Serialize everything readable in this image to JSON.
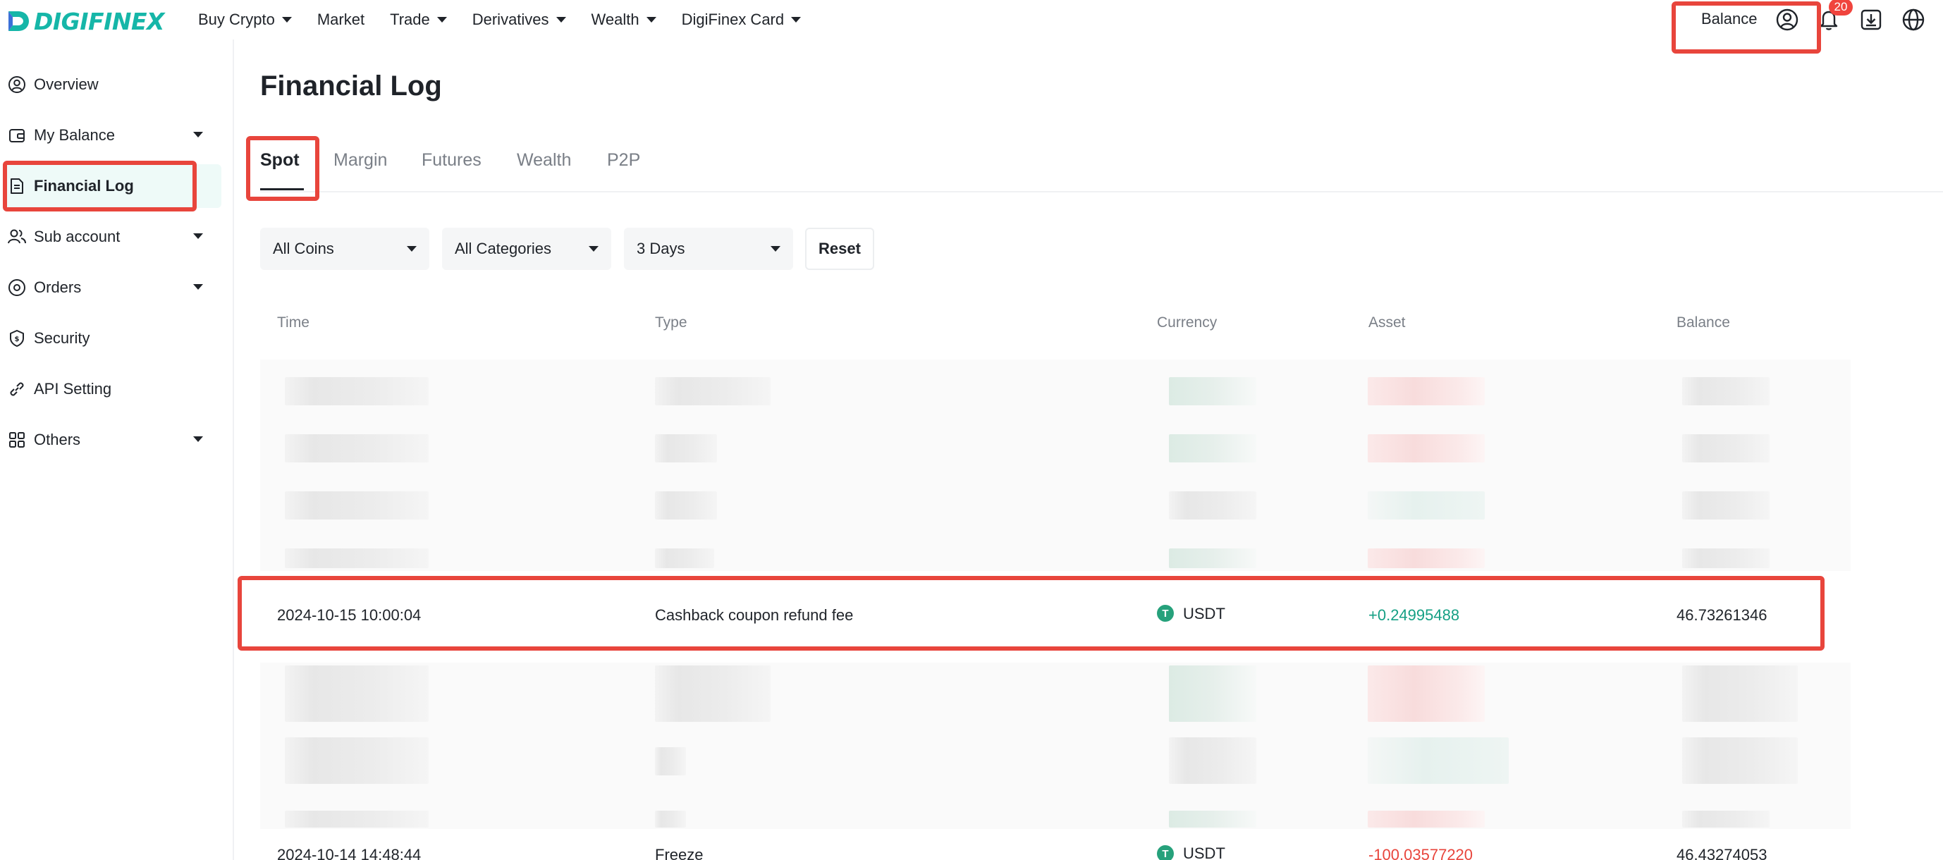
{
  "brand": {
    "name": "DIGIFINEX",
    "accent": "#16b6a8"
  },
  "nav": {
    "items": [
      {
        "label": "Buy Crypto",
        "has_dropdown": true
      },
      {
        "label": "Market",
        "has_dropdown": false
      },
      {
        "label": "Trade",
        "has_dropdown": true
      },
      {
        "label": "Derivatives",
        "has_dropdown": true
      },
      {
        "label": "Wealth",
        "has_dropdown": true
      },
      {
        "label": "DigiFinex Card",
        "has_dropdown": true
      }
    ],
    "balance_label": "Balance",
    "notification_count": "20",
    "icons": [
      "user-icon",
      "bell-icon",
      "download-icon",
      "globe-icon"
    ]
  },
  "sidebar": {
    "items": [
      {
        "label": "Overview",
        "icon": "user-circle-icon",
        "has_dropdown": false,
        "active": false
      },
      {
        "label": "My Balance",
        "icon": "wallet-icon",
        "has_dropdown": true,
        "active": false
      },
      {
        "label": "Financial Log",
        "icon": "document-icon",
        "has_dropdown": false,
        "active": true
      },
      {
        "label": "Sub account",
        "icon": "users-icon",
        "has_dropdown": true,
        "active": false
      },
      {
        "label": "Orders",
        "icon": "target-icon",
        "has_dropdown": true,
        "active": false
      },
      {
        "label": "Security",
        "icon": "shield-icon",
        "has_dropdown": false,
        "active": false
      },
      {
        "label": "API Setting",
        "icon": "link-icon",
        "has_dropdown": false,
        "active": false
      },
      {
        "label": "Others",
        "icon": "grid-icon",
        "has_dropdown": true,
        "active": false
      }
    ]
  },
  "main": {
    "title": "Financial Log",
    "tabs": [
      {
        "label": "Spot",
        "active": true
      },
      {
        "label": "Margin",
        "active": false
      },
      {
        "label": "Futures",
        "active": false
      },
      {
        "label": "Wealth",
        "active": false
      },
      {
        "label": "P2P",
        "active": false
      }
    ],
    "filters": {
      "coin": "All Coins",
      "category": "All Categories",
      "period": "3 Days",
      "reset_label": "Reset"
    },
    "table": {
      "columns": [
        "Time",
        "Type",
        "Currency",
        "Asset",
        "Balance"
      ],
      "rows": [
        {
          "time": "2024-10-15 10:00:04",
          "type": "Cashback coupon refund fee",
          "currency": "USDT",
          "asset": "+0.24995488",
          "balance": "46.73261346",
          "asset_sign": "positive"
        },
        {
          "time": "2024-10-14 14:48:44",
          "type": "Freeze",
          "currency": "USDT",
          "asset": "-100.03577220",
          "balance": "46.43274053",
          "asset_sign": "negative"
        }
      ]
    }
  },
  "colors": {
    "positive": "#16a085",
    "negative": "#e8453c",
    "highlight": "#e8453c",
    "usdt": "#26a17b"
  }
}
